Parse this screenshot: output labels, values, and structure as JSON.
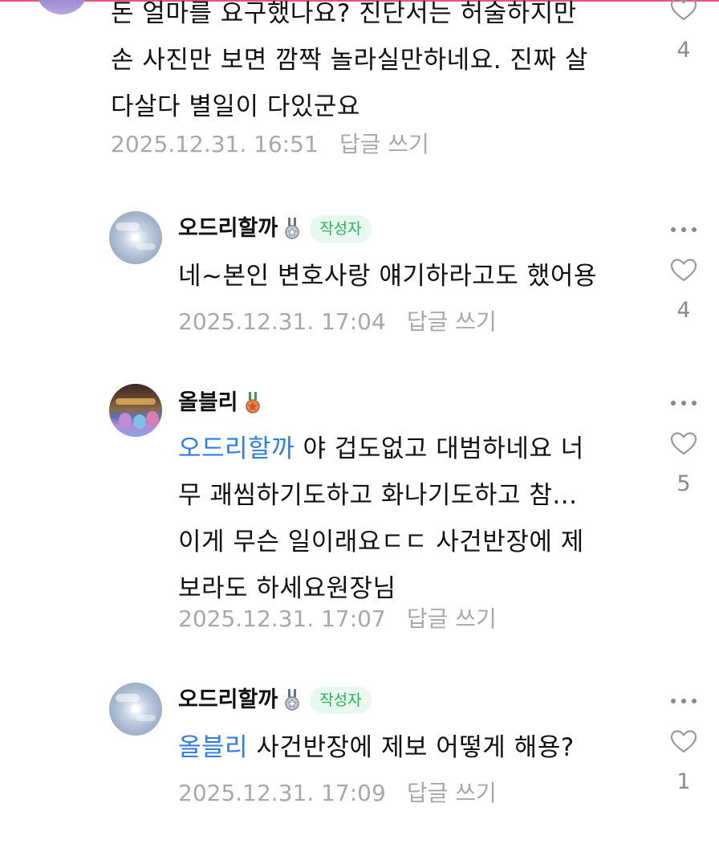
{
  "accent_colors": {
    "mention": "#2f7de1",
    "author_badge_bg": "#e9f8ee",
    "author_badge_text": "#25b158",
    "meta_text": "#a8a8a8"
  },
  "comments": [
    {
      "is_partial_top": true,
      "body_lines": [
        "돈 얼마를 요구했나요? 진단서는 허술하지만",
        "손 사진만 보면 깜짝 놀라실만하네요. 진짜 살",
        "다살다 별일이 다있군요"
      ],
      "timestamp": "2025.12.31. 16:51",
      "reply_label": "답글 쓰기",
      "likes": "4",
      "heart_icon": "heart-outline-icon"
    },
    {
      "username": "오드리할까",
      "medal_icon": "silver-medal-icon",
      "author_badge": "작성자",
      "body_text": "네~본인 변호사랑 얘기하라고도 했어용",
      "timestamp": "2025.12.31. 17:04",
      "reply_label": "답글 쓰기",
      "likes": "4",
      "more_icon": "more-dots-icon",
      "heart_icon": "heart-outline-icon"
    },
    {
      "username": "올블리",
      "medal_icon": "bronze-medal-icon",
      "mention": "오드리할까",
      "body_lines": [
        " 야 겁도없고 대범하네요 너",
        "무 괘씸하기도하고 화나기도하고 참...",
        "이게 무슨 일이래요ㄷㄷ 사건반장에 제",
        "보라도 하세요원장님"
      ],
      "timestamp": "2025.12.31. 17:07",
      "reply_label": "답글 쓰기",
      "likes": "5",
      "more_icon": "more-dots-icon",
      "heart_icon": "heart-outline-icon"
    },
    {
      "username": "오드리할까",
      "medal_icon": "silver-medal-icon",
      "author_badge": "작성자",
      "mention": "올블리",
      "body_text": " 사건반장에 제보 어떻게 해용?",
      "timestamp": "2025.12.31. 17:09",
      "reply_label": "답글 쓰기",
      "likes": "1",
      "more_icon": "more-dots-icon",
      "heart_icon": "heart-outline-icon"
    }
  ]
}
